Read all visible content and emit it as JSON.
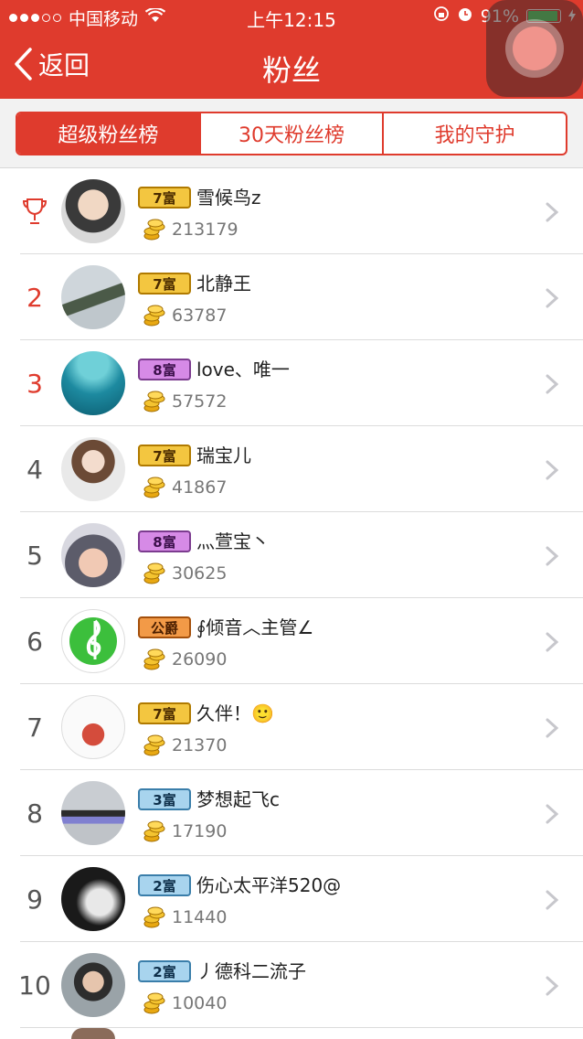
{
  "status_bar": {
    "carrier": "中国移动",
    "time": "上午12:15",
    "battery": "91%",
    "battery_level": 0.91
  },
  "nav": {
    "back_label": "返回",
    "title": "粉丝"
  },
  "tabs": [
    {
      "label": "超级粉丝榜",
      "active": true
    },
    {
      "label": "30天粉丝榜",
      "active": false
    },
    {
      "label": "我的守护",
      "active": false
    }
  ],
  "fans": [
    {
      "rank": "",
      "trophy": true,
      "badge": "7富",
      "badge_style": "gold",
      "name": "雪候鸟z",
      "coins": "213179"
    },
    {
      "rank": "2",
      "badge": "7富",
      "badge_style": "gold",
      "name": "北静王",
      "coins": "63787"
    },
    {
      "rank": "3",
      "badge": "8富",
      "badge_style": "purple",
      "name": "love、唯一",
      "coins": "57572"
    },
    {
      "rank": "4",
      "badge": "7富",
      "badge_style": "gold",
      "name": "瑞宝儿",
      "coins": "41867"
    },
    {
      "rank": "5",
      "badge": "8富",
      "badge_style": "purple",
      "name": "灬萱宝丶",
      "coins": "30625"
    },
    {
      "rank": "6",
      "badge": "公爵",
      "badge_style": "orange",
      "name": "∮倾音︿主管∠",
      "coins": "26090"
    },
    {
      "rank": "7",
      "badge": "7富",
      "badge_style": "gold",
      "name": "久伴！🙂",
      "coins": "21370"
    },
    {
      "rank": "8",
      "badge": "3富",
      "badge_style": "blue",
      "name": "梦想起飞c",
      "coins": "17190"
    },
    {
      "rank": "9",
      "badge": "2富",
      "badge_style": "blue",
      "name": "伤心太平洋520@",
      "coins": "11440"
    },
    {
      "rank": "10",
      "badge": "2富",
      "badge_style": "blue",
      "name": "丿德科二流子",
      "coins": "10040"
    }
  ],
  "colors": {
    "accent": "#df3b2d",
    "rank_top": "#df3b2d"
  }
}
